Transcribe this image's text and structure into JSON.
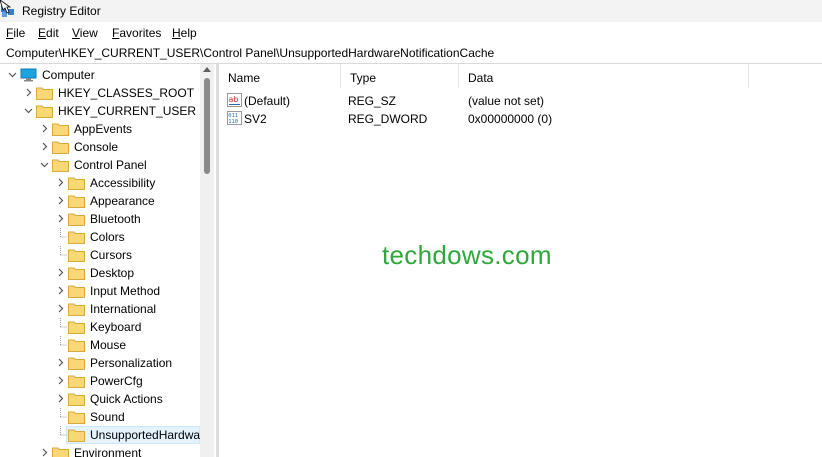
{
  "window": {
    "title": "Registry Editor"
  },
  "menu": {
    "items": [
      {
        "label": "File",
        "mnemonic": "F",
        "rest": "ile"
      },
      {
        "label": "Edit",
        "mnemonic": "E",
        "rest": "dit"
      },
      {
        "label": "View",
        "mnemonic": "V",
        "rest": "iew"
      },
      {
        "label": "Favorites",
        "mnemonic": "F",
        "rest": "avorites"
      },
      {
        "label": "Help",
        "mnemonic": "H",
        "rest": "elp"
      }
    ]
  },
  "address": {
    "path": "Computer\\HKEY_CURRENT_USER\\Control Panel\\UnsupportedHardwareNotificationCache"
  },
  "tree": {
    "root": "Computer",
    "hkcr": "HKEY_CLASSES_ROOT",
    "hkcu": "HKEY_CURRENT_USER",
    "app_events": "AppEvents",
    "console": "Console",
    "control_panel": "Control Panel",
    "children": [
      {
        "label": "Accessibility",
        "expandable": true
      },
      {
        "label": "Appearance",
        "expandable": true
      },
      {
        "label": "Bluetooth",
        "expandable": true
      },
      {
        "label": "Colors",
        "expandable": false
      },
      {
        "label": "Cursors",
        "expandable": false
      },
      {
        "label": "Desktop",
        "expandable": true
      },
      {
        "label": "Input Method",
        "expandable": true
      },
      {
        "label": "International",
        "expandable": true
      },
      {
        "label": "Keyboard",
        "expandable": false
      },
      {
        "label": "Mouse",
        "expandable": false
      },
      {
        "label": "Personalization",
        "expandable": true
      },
      {
        "label": "PowerCfg",
        "expandable": true
      },
      {
        "label": "Quick Actions",
        "expandable": true
      },
      {
        "label": "Sound",
        "expandable": false
      },
      {
        "label": "UnsupportedHardwa",
        "expandable": false,
        "selected": true
      }
    ],
    "environment": "Environment"
  },
  "list": {
    "columns": {
      "name": "Name",
      "type": "Type",
      "data": "Data"
    },
    "rows": [
      {
        "name": "(Default)",
        "type": "REG_SZ",
        "data": "(value not set)",
        "icon": "string-value-icon"
      },
      {
        "name": "SV2",
        "type": "REG_DWORD",
        "data": "0x00000000 (0)",
        "icon": "dword-value-icon"
      }
    ]
  },
  "watermark": "techdows.com",
  "colors": {
    "folder": "#f8d775",
    "selection": "#e5f3ff",
    "watermark": "#2ea83a"
  }
}
